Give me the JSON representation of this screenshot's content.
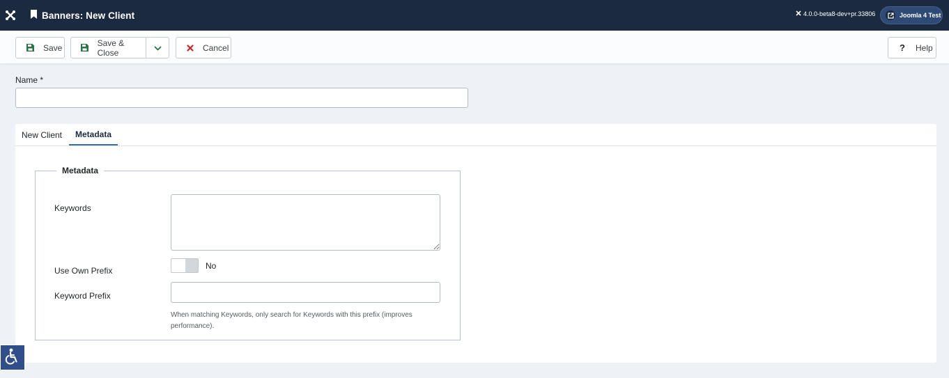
{
  "header": {
    "title": "Banners: New Client",
    "version": "4.0.0-beta8-dev+pr.33806",
    "site_name": "Joomla 4 Test",
    "background": "#1c2a40"
  },
  "toolbar": {
    "save_label": "Save",
    "save_close_label": "Save & Close",
    "cancel_label": "Cancel",
    "help_label": "Help",
    "save_icon": "floppy-disk-icon",
    "cancel_icon": "close-icon",
    "help_icon": "question-icon",
    "accent_save": "#2a7144",
    "accent_cancel": "#c52827"
  },
  "form": {
    "name_label": "Name *",
    "name_value": ""
  },
  "tabs": [
    {
      "label": "New Client",
      "active": false
    },
    {
      "label": "Metadata",
      "active": true
    }
  ],
  "metadata": {
    "legend": "Metadata",
    "keywords_label": "Keywords",
    "keywords_value": "",
    "use_own_prefix_label": "Use Own Prefix",
    "use_own_prefix_value": "No",
    "keyword_prefix_label": "Keyword Prefix",
    "keyword_prefix_value": "",
    "keyword_prefix_hint": "When matching Keywords, only search for Keywords with this prefix (improves performance)."
  },
  "accessibility": {
    "icon": "accessibility-icon"
  }
}
